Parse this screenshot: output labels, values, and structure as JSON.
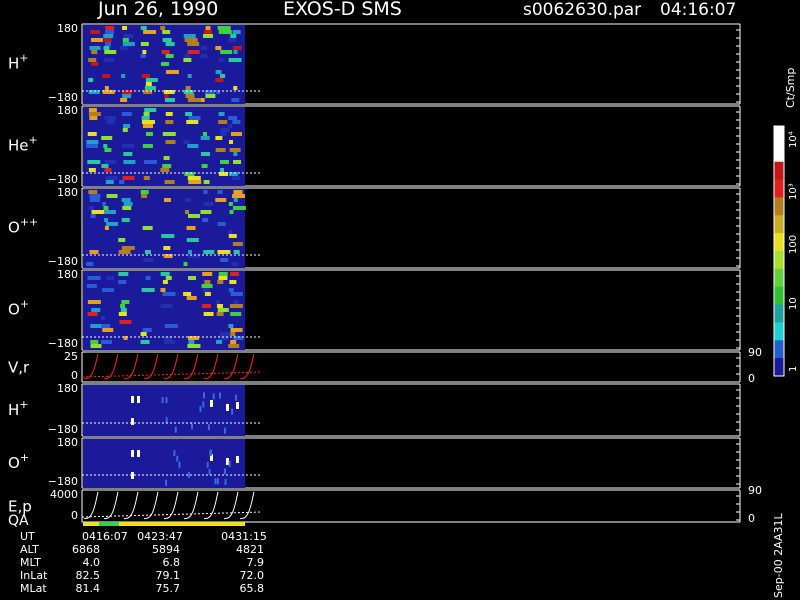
{
  "header": {
    "date": "Jun 26, 1990",
    "instrument": "EXOS-D SMS",
    "file": "s0062630.par",
    "time": "04:16:07"
  },
  "colorbar": {
    "unit": "Ct/Smp",
    "ticks": [
      "10⁴",
      "10³",
      "100",
      "10",
      "1"
    ]
  },
  "side_label": "Sep-00 2AA31L",
  "chart_data": {
    "type": "heatmap",
    "panels": [
      {
        "id": "p1",
        "label_base": "H",
        "label_sup": "+",
        "y_top": "180",
        "y_bot": "−180",
        "kind": "spectrogram",
        "bg": "#1a1a9a",
        "intensity": 1.0
      },
      {
        "id": "p2",
        "label_base": "He",
        "label_sup": "+",
        "y_top": "180",
        "y_bot": "−180",
        "kind": "spectrogram",
        "bg": "#1a1a9a",
        "intensity": 0.65
      },
      {
        "id": "p3",
        "label_base": "O",
        "label_sup": "++",
        "y_top": "180",
        "y_bot": "−180",
        "kind": "spectrogram",
        "bg": "#1a1a9a",
        "intensity": 0.55
      },
      {
        "id": "p4",
        "label_base": "O",
        "label_sup": "+",
        "y_top": "180",
        "y_bot": "−180",
        "kind": "spectrogram",
        "bg": "#1a1a9a",
        "intensity": 0.7
      },
      {
        "id": "p5",
        "label_base": "V,r",
        "label_sup": "",
        "y_top": "25",
        "y_bot": "0",
        "right_top": "90",
        "right_bot": "0",
        "kind": "line",
        "color": "#ff2020"
      },
      {
        "id": "p6",
        "label_base": "H",
        "label_sup": "+",
        "y_top": "180",
        "y_bot": "−180",
        "kind": "sparse",
        "bg": "#1a1a9a"
      },
      {
        "id": "p7",
        "label_base": "O",
        "label_sup": "+",
        "y_top": "180",
        "y_bot": "−180",
        "kind": "sparse",
        "bg": "#1a1a9a"
      },
      {
        "id": "p8",
        "label_base": "E,p",
        "label_line2": "QA",
        "label_sup": "",
        "y_top": "4000",
        "y_bot": "0",
        "right_top": "90",
        "right_bot": "0",
        "kind": "line",
        "color": "#ffffff"
      }
    ],
    "x_ticks": [
      "0416:07",
      "0423:47",
      "0431:15"
    ],
    "ephemeris": [
      {
        "name": "UT",
        "values": [
          "0416:07",
          "0423:47",
          "0431:15"
        ]
      },
      {
        "name": "ALT",
        "values": [
          "6868",
          "5894",
          "4821"
        ]
      },
      {
        "name": "MLT",
        "values": [
          "4.0",
          "6.8",
          "7.9"
        ]
      },
      {
        "name": "InLat",
        "values": [
          "82.5",
          "79.1",
          "72.0"
        ]
      },
      {
        "name": "MLat",
        "values": [
          "81.4",
          "75.7",
          "65.8"
        ]
      }
    ]
  }
}
